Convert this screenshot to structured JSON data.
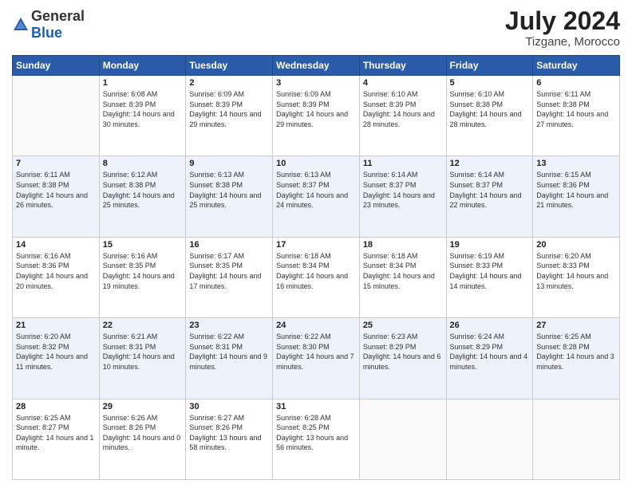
{
  "logo": {
    "general": "General",
    "blue": "Blue"
  },
  "header": {
    "month_year": "July 2024",
    "location": "Tizgane, Morocco"
  },
  "weekdays": [
    "Sunday",
    "Monday",
    "Tuesday",
    "Wednesday",
    "Thursday",
    "Friday",
    "Saturday"
  ],
  "weeks": [
    [
      {
        "day": "",
        "info": ""
      },
      {
        "day": "1",
        "info": "Sunrise: 6:08 AM\nSunset: 8:39 PM\nDaylight: 14 hours\nand 30 minutes."
      },
      {
        "day": "2",
        "info": "Sunrise: 6:09 AM\nSunset: 8:39 PM\nDaylight: 14 hours\nand 29 minutes."
      },
      {
        "day": "3",
        "info": "Sunrise: 6:09 AM\nSunset: 8:39 PM\nDaylight: 14 hours\nand 29 minutes."
      },
      {
        "day": "4",
        "info": "Sunrise: 6:10 AM\nSunset: 8:39 PM\nDaylight: 14 hours\nand 28 minutes."
      },
      {
        "day": "5",
        "info": "Sunrise: 6:10 AM\nSunset: 8:38 PM\nDaylight: 14 hours\nand 28 minutes."
      },
      {
        "day": "6",
        "info": "Sunrise: 6:11 AM\nSunset: 8:38 PM\nDaylight: 14 hours\nand 27 minutes."
      }
    ],
    [
      {
        "day": "7",
        "info": "Sunrise: 6:11 AM\nSunset: 8:38 PM\nDaylight: 14 hours\nand 26 minutes."
      },
      {
        "day": "8",
        "info": "Sunrise: 6:12 AM\nSunset: 8:38 PM\nDaylight: 14 hours\nand 25 minutes."
      },
      {
        "day": "9",
        "info": "Sunrise: 6:13 AM\nSunset: 8:38 PM\nDaylight: 14 hours\nand 25 minutes."
      },
      {
        "day": "10",
        "info": "Sunrise: 6:13 AM\nSunset: 8:37 PM\nDaylight: 14 hours\nand 24 minutes."
      },
      {
        "day": "11",
        "info": "Sunrise: 6:14 AM\nSunset: 8:37 PM\nDaylight: 14 hours\nand 23 minutes."
      },
      {
        "day": "12",
        "info": "Sunrise: 6:14 AM\nSunset: 8:37 PM\nDaylight: 14 hours\nand 22 minutes."
      },
      {
        "day": "13",
        "info": "Sunrise: 6:15 AM\nSunset: 8:36 PM\nDaylight: 14 hours\nand 21 minutes."
      }
    ],
    [
      {
        "day": "14",
        "info": "Sunrise: 6:16 AM\nSunset: 8:36 PM\nDaylight: 14 hours\nand 20 minutes."
      },
      {
        "day": "15",
        "info": "Sunrise: 6:16 AM\nSunset: 8:35 PM\nDaylight: 14 hours\nand 19 minutes."
      },
      {
        "day": "16",
        "info": "Sunrise: 6:17 AM\nSunset: 8:35 PM\nDaylight: 14 hours\nand 17 minutes."
      },
      {
        "day": "17",
        "info": "Sunrise: 6:18 AM\nSunset: 8:34 PM\nDaylight: 14 hours\nand 16 minutes."
      },
      {
        "day": "18",
        "info": "Sunrise: 6:18 AM\nSunset: 8:34 PM\nDaylight: 14 hours\nand 15 minutes."
      },
      {
        "day": "19",
        "info": "Sunrise: 6:19 AM\nSunset: 8:33 PM\nDaylight: 14 hours\nand 14 minutes."
      },
      {
        "day": "20",
        "info": "Sunrise: 6:20 AM\nSunset: 8:33 PM\nDaylight: 14 hours\nand 13 minutes."
      }
    ],
    [
      {
        "day": "21",
        "info": "Sunrise: 6:20 AM\nSunset: 8:32 PM\nDaylight: 14 hours\nand 11 minutes."
      },
      {
        "day": "22",
        "info": "Sunrise: 6:21 AM\nSunset: 8:31 PM\nDaylight: 14 hours\nand 10 minutes."
      },
      {
        "day": "23",
        "info": "Sunrise: 6:22 AM\nSunset: 8:31 PM\nDaylight: 14 hours\nand 9 minutes."
      },
      {
        "day": "24",
        "info": "Sunrise: 6:22 AM\nSunset: 8:30 PM\nDaylight: 14 hours\nand 7 minutes."
      },
      {
        "day": "25",
        "info": "Sunrise: 6:23 AM\nSunset: 8:29 PM\nDaylight: 14 hours\nand 6 minutes."
      },
      {
        "day": "26",
        "info": "Sunrise: 6:24 AM\nSunset: 8:29 PM\nDaylight: 14 hours\nand 4 minutes."
      },
      {
        "day": "27",
        "info": "Sunrise: 6:25 AM\nSunset: 8:28 PM\nDaylight: 14 hours\nand 3 minutes."
      }
    ],
    [
      {
        "day": "28",
        "info": "Sunrise: 6:25 AM\nSunset: 8:27 PM\nDaylight: 14 hours\nand 1 minute."
      },
      {
        "day": "29",
        "info": "Sunrise: 6:26 AM\nSunset: 8:26 PM\nDaylight: 14 hours\nand 0 minutes."
      },
      {
        "day": "30",
        "info": "Sunrise: 6:27 AM\nSunset: 8:26 PM\nDaylight: 13 hours\nand 58 minutes."
      },
      {
        "day": "31",
        "info": "Sunrise: 6:28 AM\nSunset: 8:25 PM\nDaylight: 13 hours\nand 56 minutes."
      },
      {
        "day": "",
        "info": ""
      },
      {
        "day": "",
        "info": ""
      },
      {
        "day": "",
        "info": ""
      }
    ]
  ]
}
